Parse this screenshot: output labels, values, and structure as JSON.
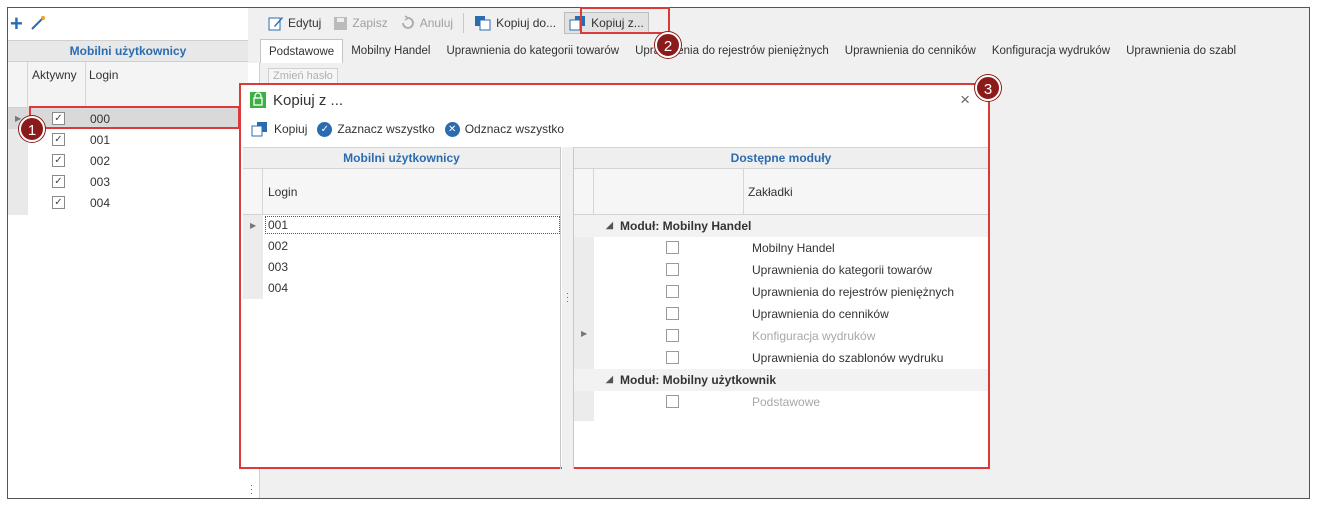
{
  "left_panel": {
    "title": "Mobilni użytkownicy",
    "columns": [
      "Aktywny",
      "Login"
    ],
    "rows": [
      {
        "login": "000",
        "active": true
      },
      {
        "login": "001",
        "active": true
      },
      {
        "login": "002",
        "active": true
      },
      {
        "login": "003",
        "active": true
      },
      {
        "login": "004",
        "active": true
      }
    ],
    "check_glyph": "✓"
  },
  "toolbar": {
    "edit": "Edytuj",
    "save": "Zapisz",
    "cancel": "Anuluj",
    "copy_to": "Kopiuj do...",
    "copy_from": "Kopiuj z..."
  },
  "tabs": [
    "Podstawowe",
    "Mobilny Handel",
    "Uprawnienia do kategorii towarów",
    "Uprawnienia do rejestrów pieniężnych",
    "Uprawnienia do cenników",
    "Konfiguracja wydruków",
    "Uprawnienia do szabl"
  ],
  "change_password": "Zmień hasło",
  "dialog": {
    "title": "Kopiuj z ...",
    "close": "×",
    "toolbar": {
      "copy": "Kopiuj",
      "select_all": "Zaznacz wszystko",
      "deselect_all": "Odznacz wszystko"
    },
    "left_grid": {
      "title": "Mobilni użytkownicy",
      "column": "Login",
      "rows": [
        "001",
        "002",
        "003",
        "004"
      ]
    },
    "right_grid": {
      "title": "Dostępne moduły",
      "column": "Zakładki",
      "groups": [
        {
          "label": "Moduł: Mobilny Handel",
          "items": [
            {
              "label": "Mobilny Handel",
              "enabled": true
            },
            {
              "label": "Uprawnienia do kategorii towarów",
              "enabled": true
            },
            {
              "label": "Uprawnienia do rejestrów pieniężnych",
              "enabled": true
            },
            {
              "label": "Uprawnienia do cenników",
              "enabled": true
            },
            {
              "label": "Konfiguracja wydruków",
              "enabled": false
            },
            {
              "label": "Uprawnienia do szablonów wydruku",
              "enabled": true
            }
          ]
        },
        {
          "label": "Moduł: Mobilny użytkownik",
          "items": [
            {
              "label": "Podstawowe",
              "enabled": false
            }
          ]
        }
      ]
    }
  },
  "callouts": [
    "1",
    "2",
    "3"
  ],
  "colors": {
    "accent_blue": "#2b6cb0",
    "callout_red": "#8b1a1a",
    "highlight_red": "#d93a3a"
  }
}
